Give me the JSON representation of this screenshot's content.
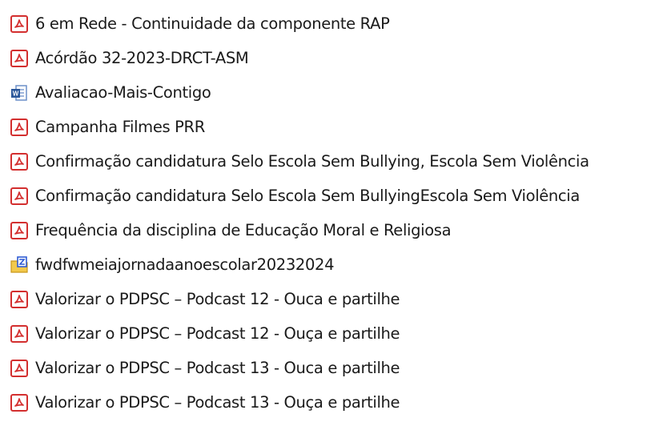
{
  "files": [
    {
      "name": "6 em Rede - Continuidade da componente RAP",
      "icon": "pdf-icon"
    },
    {
      "name": "Acórdão 32-2023-DRCT-ASM",
      "icon": "pdf-icon"
    },
    {
      "name": "Avaliacao-Mais-Contigo",
      "icon": "word-icon"
    },
    {
      "name": "Campanha Filmes PRR",
      "icon": "pdf-icon"
    },
    {
      "name": "Confirmação candidatura Selo Escola Sem Bullying, Escola Sem Violência",
      "icon": "pdf-icon"
    },
    {
      "name": "Confirmação candidatura Selo Escola Sem BullyingEscola Sem Violência",
      "icon": "pdf-icon"
    },
    {
      "name": "Frequência da disciplina de Educação Moral e Religiosa",
      "icon": "pdf-icon"
    },
    {
      "name": "fwdfwmeiajornadaanoescolar20232024",
      "icon": "zip-folder-icon"
    },
    {
      "name": "Valorizar o PDPSC – Podcast 12 - Ouca e partilhe",
      "icon": "pdf-icon"
    },
    {
      "name": "Valorizar o PDPSC – Podcast 12 - Ouça e partilhe",
      "icon": "pdf-icon"
    },
    {
      "name": "Valorizar o PDPSC – Podcast 13 - Ouca e partilhe",
      "icon": "pdf-icon"
    },
    {
      "name": "Valorizar o PDPSC – Podcast 13 - Ouça e partilhe",
      "icon": "pdf-icon"
    }
  ],
  "colors": {
    "pdf_red": "#d32f2f",
    "word_blue": "#2b579a",
    "zip_yellow": "#f2c94c",
    "zip_blue": "#2f5bd3",
    "text": "#1a1a1a"
  }
}
